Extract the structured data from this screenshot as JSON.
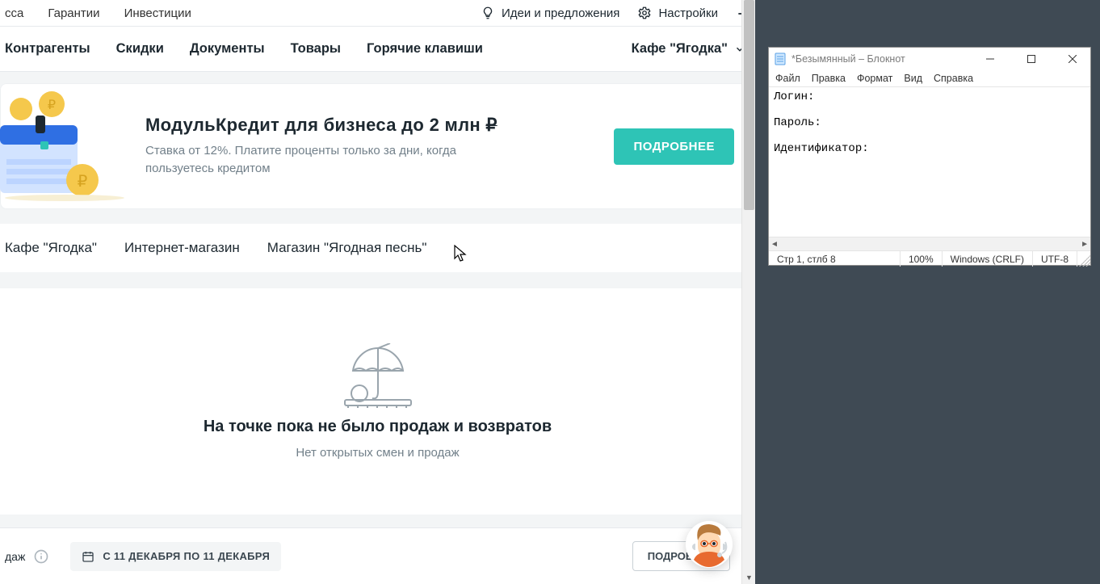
{
  "topbar": {
    "left": [
      "сса",
      "Гарантии",
      "Инвестиции"
    ],
    "ideas": "Идеи и предложения",
    "settings": "Настройки"
  },
  "nav": {
    "items": [
      "Контрагенты",
      "Скидки",
      "Документы",
      "Товары",
      "Горячие клавиши"
    ],
    "account": "Кафе \"Ягодка\""
  },
  "promo": {
    "title_a": "МодульКредит для бизнеса до 2 млн ",
    "title_rub": "₽",
    "sub": "Ставка от 12%. Платите проценты только за дни, когда пользуетесь кредитом",
    "cta": "ПОДРОБНЕЕ"
  },
  "tabs": [
    "Кафе \"Ягодка\"",
    "Интернет-магазин",
    "Магазин \"Ягодная песнь\""
  ],
  "empty": {
    "title": "На точке пока не было продаж и возвратов",
    "sub": "Нет открытых смен и продаж"
  },
  "bottom": {
    "hint": "даж",
    "range": "С 11 ДЕКАБРЯ ПО 11 ДЕКАБРЯ",
    "details": "ПОДРОБНЕЕ"
  },
  "notepad": {
    "title": "*Безымянный – Блокнот",
    "menu": [
      "Файл",
      "Правка",
      "Формат",
      "Вид",
      "Справка"
    ],
    "body": "Логин:\n\nПароль:\n\nИдентификатор:",
    "status": {
      "pos": "Стр 1, стлб 8",
      "zoom": "100%",
      "eol": "Windows (CRLF)",
      "enc": "UTF-8"
    }
  }
}
